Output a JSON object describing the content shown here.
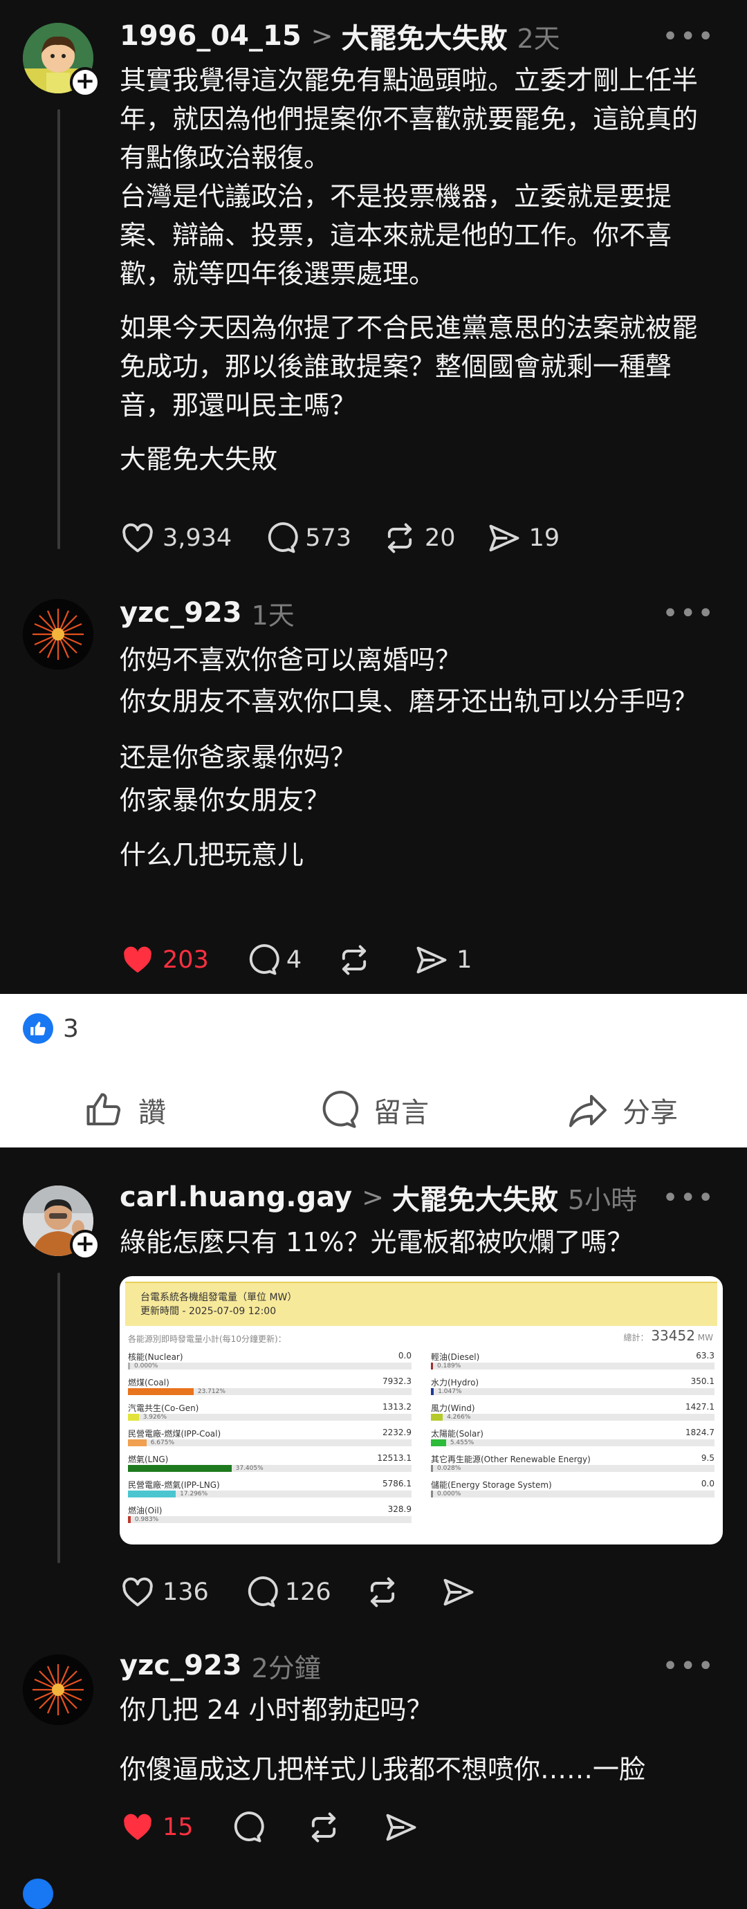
{
  "posts": [
    {
      "username": "1996_04_15",
      "topic": "大罷免大失敗",
      "time": "2天",
      "paragraphs": [
        "其實我覺得這次罷免有點過頭啦。立委才剛上任半年，就因為他們提案你不喜歡就要罷免，這說真的有點像政治報復。\n台灣是代議政治，不是投票機器，立委就是要提案、辯論、投票，這本來就是他的工作。你不喜歡，就等四年後選票處理。",
        "如果今天因為你提了不合民進黨意思的法案就被罷免成功，那以後誰敢提案？整個國會就剩一種聲音，那還叫民主嗎？",
        "大罷免大失敗"
      ],
      "likes": "3,934",
      "comments": "573",
      "reposts": "20",
      "shares": "19"
    },
    {
      "username": "yzc_923",
      "time": "1天",
      "paragraphs": [
        "你妈不喜欢你爸可以离婚吗？\n你女朋友不喜欢你口臭、磨牙还出轨可以分手吗？",
        "还是你爸家暴你妈？\n你家暴你女朋友？",
        "什么几把玩意儿"
      ],
      "likes": "203",
      "comments": "4",
      "reposts": "",
      "shares": "1"
    },
    {
      "username": "carl.huang.gay",
      "topic": "大罷免大失敗",
      "time": "5小時",
      "paragraphs": [
        "綠能怎麼只有 11%？光電板都被吹爛了嗎？"
      ],
      "likes": "136",
      "comments": "126",
      "reposts": "",
      "shares": ""
    },
    {
      "username": "yzc_923",
      "time": "2分鐘",
      "paragraphs": [
        "你几把 24 小时都勃起吗？",
        "你傻逼成这几把样式儿我都不想喷你……一脸"
      ],
      "likes": "15",
      "comments": "",
      "reposts": "",
      "shares": ""
    }
  ],
  "facebook": {
    "like_count": "3",
    "like_label": "讚",
    "comment_label": "留言",
    "share_label": "分享"
  },
  "power_table": {
    "title": "台電系統各機組發電量（單位 MW）",
    "updated": "更新時間 - 2025-07-09 12:00",
    "subtitle": "各能源別即時發電量小計(每10分鐘更新)：",
    "total_label": "總計：",
    "total_value": "33452",
    "total_unit": "MW",
    "left": [
      {
        "label": "核能(Nuclear)",
        "value": "0.0",
        "pct": "0.000%",
        "share": 0.0,
        "color": "#b0b0b0"
      },
      {
        "label": "燃煤(Coal)",
        "value": "7932.3",
        "pct": "23.712%",
        "share": 23.712,
        "color": "#e8741e"
      },
      {
        "label": "汽電共生(Co-Gen)",
        "value": "1313.2",
        "pct": "3.926%",
        "share": 3.926,
        "color": "#e2e33a"
      },
      {
        "label": "民營電廠-燃煤(IPP-Coal)",
        "value": "2232.9",
        "pct": "6.675%",
        "share": 6.675,
        "color": "#f0a050"
      },
      {
        "label": "燃氣(LNG)",
        "value": "12513.1",
        "pct": "37.405%",
        "share": 37.405,
        "color": "#1f7a1f"
      },
      {
        "label": "民營電廠-燃氣(IPP-LNG)",
        "value": "5786.1",
        "pct": "17.296%",
        "share": 17.296,
        "color": "#4bc6d0"
      },
      {
        "label": "燃油(Oil)",
        "value": "328.9",
        "pct": "0.983%",
        "share": 0.983,
        "color": "#c0392b"
      }
    ],
    "right": [
      {
        "label": "輕油(Diesel)",
        "value": "63.3",
        "pct": "0.189%",
        "share": 0.189,
        "color": "#9b2f2f"
      },
      {
        "label": "水力(Hydro)",
        "value": "350.1",
        "pct": "1.047%",
        "share": 1.047,
        "color": "#1e3a9a"
      },
      {
        "label": "風力(Wind)",
        "value": "1427.1",
        "pct": "4.266%",
        "share": 4.266,
        "color": "#b6c92a"
      },
      {
        "label": "太陽能(Solar)",
        "value": "1824.7",
        "pct": "5.455%",
        "share": 5.455,
        "color": "#2dbb3a"
      },
      {
        "label": "其它再生能源(Other Renewable Energy)",
        "value": "9.5",
        "pct": "0.028%",
        "share": 0.028,
        "color": "#888888"
      },
      {
        "label": "儲能(Energy Storage System)",
        "value": "0.0",
        "pct": "0.000%",
        "share": 0.0,
        "color": "#888888"
      }
    ]
  }
}
